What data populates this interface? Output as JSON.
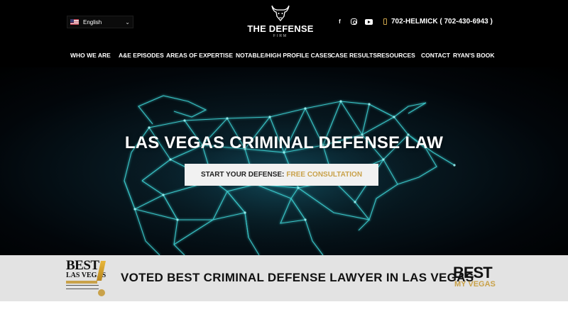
{
  "header": {
    "language": {
      "label": "English",
      "flag_icon": "us-flag-icon"
    },
    "logo": {
      "title": "THE DEFENSE",
      "subtitle": "FIRM",
      "icon": "bull-head-icon"
    },
    "social": [
      {
        "name": "facebook-icon",
        "glyph": "f"
      },
      {
        "name": "instagram-icon",
        "glyph": ""
      },
      {
        "name": "youtube-icon",
        "glyph": ""
      }
    ],
    "phone": "702-HELMICK ( 702-430-6943 )"
  },
  "nav": [
    {
      "label": "WHO WE ARE"
    },
    {
      "label": "A&E EPISODES"
    },
    {
      "label": "AREAS OF EXPERTISE"
    },
    {
      "label": "NOTABLE/HIGH PROFILE CASES"
    },
    {
      "label": "CASE RESULTS"
    },
    {
      "label": "RESOURCES"
    },
    {
      "label": "CONTACT"
    },
    {
      "label": "RYAN'S BOOK"
    }
  ],
  "hero": {
    "title": "LAS VEGAS CRIMINAL DEFENSE LAW",
    "cta_prefix": "START YOUR DEFENSE:",
    "cta_highlight": "FREE CONSULTATION"
  },
  "band": {
    "badge_left": {
      "title": "BEST",
      "sub": "LAS VEGAS"
    },
    "text": "VOTED BEST CRIMINAL DEFENSE LAWYER IN LAS VEGAS",
    "badge_right": {
      "title": "BEST",
      "sub": "MY VEGAS"
    }
  },
  "colors": {
    "gold": "#c9a24a",
    "header_bg": "#000000",
    "band_bg": "#e3e3e3",
    "glow": "#34d6d6"
  }
}
